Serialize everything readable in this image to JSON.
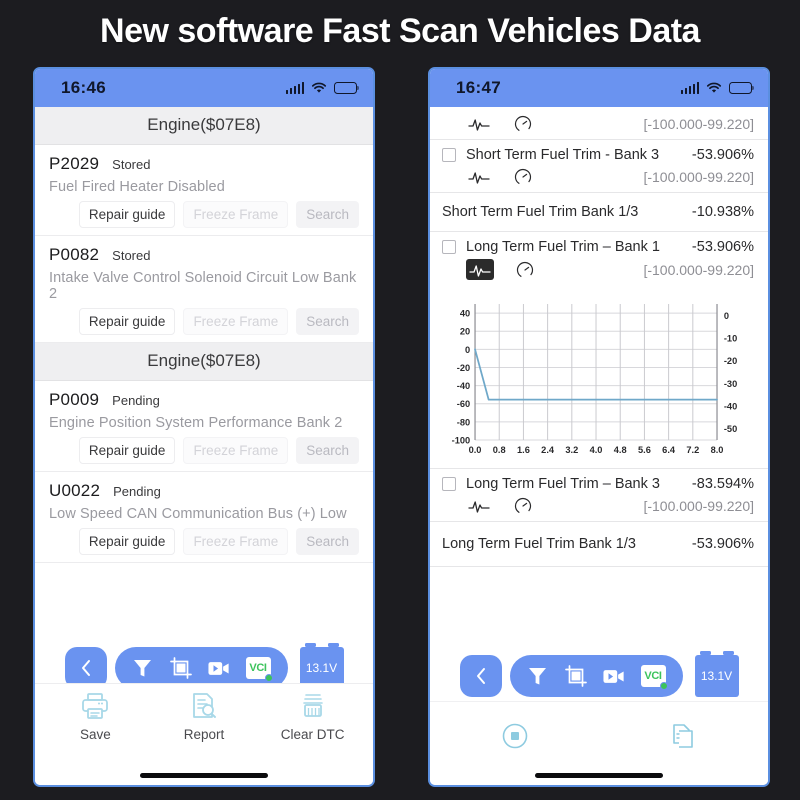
{
  "banner": {
    "title": "New software Fast Scan Vehicles Data"
  },
  "colors": {
    "accent_blue": "#6a93f0",
    "page_background": "#1c1c20",
    "section_header_bg": "#efeff1",
    "chart_line": "#6fa8c9",
    "vci_green": "#3cc35c",
    "muted_text": "#9a9aa0"
  },
  "left_phone": {
    "status_bar": {
      "time": "16:46",
      "signal_icon": "signal-bars-icon",
      "wifi_icon": "wifi-icon",
      "battery_icon": "battery-icon"
    },
    "sections": [
      {
        "header": "Engine($07E8)",
        "codes": [
          {
            "code": "P2029",
            "status": "Stored",
            "description": "Fuel Fired Heater Disabled",
            "buttons": {
              "repair": "Repair guide",
              "freeze": "Freeze Frame",
              "search": "Search"
            }
          },
          {
            "code": "P0082",
            "status": "Stored",
            "description": "Intake Valve Control Solenoid Circuit Low Bank 2",
            "buttons": {
              "repair": "Repair guide",
              "freeze": "Freeze Frame",
              "search": "Search"
            }
          }
        ]
      },
      {
        "header": "Engine($07E8)",
        "codes": [
          {
            "code": "P0009",
            "status": "Pending",
            "description": "Engine Position System Performance Bank 2",
            "buttons": {
              "repair": "Repair guide",
              "freeze": "Freeze Frame",
              "search": "Search"
            }
          },
          {
            "code": "U0022",
            "status": "Pending",
            "description": "Low Speed CAN Communication Bus (+) Low",
            "buttons": {
              "repair": "Repair guide",
              "freeze": "Freeze Frame",
              "search": "Search"
            }
          }
        ]
      }
    ],
    "float_toolbar": {
      "back_icon": "chevron-left-icon",
      "filter_icon": "funnel-icon",
      "screenshot_icon": "crop-screenshot-icon",
      "record_icon": "video-record-icon",
      "vci_label": "VCI",
      "battery_voltage": "13.1V"
    },
    "action_bar": [
      {
        "icon": "printer-icon",
        "label": "Save"
      },
      {
        "icon": "report-search-icon",
        "label": "Report"
      },
      {
        "icon": "brush-clear-icon",
        "label": "Clear DTC"
      }
    ]
  },
  "right_phone": {
    "status_bar": {
      "time": "16:47",
      "signal_icon": "signal-bars-icon",
      "wifi_icon": "wifi-icon",
      "battery_icon": "battery-icon"
    },
    "rows": [
      {
        "type": "partial",
        "name": "",
        "value": "",
        "range": "[-100.000-99.220]",
        "wave_active": false
      },
      {
        "type": "data",
        "name": "Short Term Fuel Trim - Bank 3",
        "value": "-53.906%",
        "range": "[-100.000-99.220]",
        "wave_active": false
      },
      {
        "type": "plain",
        "name": "Short Term Fuel Trim Bank 1/3",
        "value": "-10.938%"
      },
      {
        "type": "chart",
        "name": "Long Term Fuel Trim – Bank 1",
        "value": "-53.906%",
        "range": "[-100.000-99.220]",
        "wave_active": true
      },
      {
        "type": "data",
        "name": "Long Term Fuel Trim – Bank 3",
        "value": "-83.594%",
        "range": "[-100.000-99.220]",
        "wave_active": false
      },
      {
        "type": "plain",
        "name": "Long Term Fuel Trim Bank 1/3",
        "value": "-53.906%"
      }
    ],
    "float_toolbar": {
      "back_icon": "chevron-left-icon",
      "filter_icon": "funnel-icon",
      "screenshot_icon": "crop-screenshot-icon",
      "record_icon": "video-record-icon",
      "vci_label": "VCI",
      "battery_voltage": "13.1V"
    },
    "action_bar": [
      {
        "icon": "stop-record-icon",
        "label": ""
      },
      {
        "icon": "compare-report-icon",
        "label": ""
      }
    ]
  },
  "chart_data": {
    "type": "line",
    "title": "Long Term Fuel Trim – Bank 1",
    "xlabel": "",
    "ylabel": "",
    "x": [
      0.0,
      0.8,
      1.6,
      2.4,
      3.2,
      4.0,
      4.8,
      5.6,
      6.4,
      7.2,
      8.0
    ],
    "xticklabels": [
      "0.0",
      "0.8",
      "1.6",
      "2.4",
      "3.2",
      "4.0",
      "4.8",
      "5.6",
      "6.4",
      "7.2",
      "8.0"
    ],
    "xlim": [
      0.0,
      8.0
    ],
    "ylim": [
      -100,
      50
    ],
    "yticks": [
      40,
      20,
      0,
      -20,
      -40,
      -60,
      -80,
      -100
    ],
    "yticklabels": [
      "40",
      "20",
      "0",
      "-20",
      "-40",
      "-60",
      "-80",
      "-100"
    ],
    "y2ticks": [
      0,
      -10,
      -20,
      -30,
      -40,
      -50
    ],
    "y2ticklabels": [
      "0",
      "-10",
      "-20",
      "-30",
      "-40",
      "-50"
    ],
    "y2lim": [
      -55,
      5
    ],
    "grid": true,
    "legend": "none",
    "series": [
      {
        "name": "Long Term Fuel Trim – Bank 1",
        "color": "#6fa8c9",
        "points": [
          [
            0.0,
            0.0
          ],
          [
            0.45,
            -55.5
          ],
          [
            0.8,
            -55.5
          ],
          [
            1.6,
            -55.5
          ],
          [
            2.4,
            -55.5
          ],
          [
            3.2,
            -55.5
          ],
          [
            4.0,
            -55.5
          ],
          [
            4.8,
            -55.5
          ],
          [
            5.6,
            -55.5
          ],
          [
            6.4,
            -55.5
          ],
          [
            7.2,
            -55.5
          ],
          [
            8.0,
            -55.5
          ]
        ]
      }
    ]
  }
}
